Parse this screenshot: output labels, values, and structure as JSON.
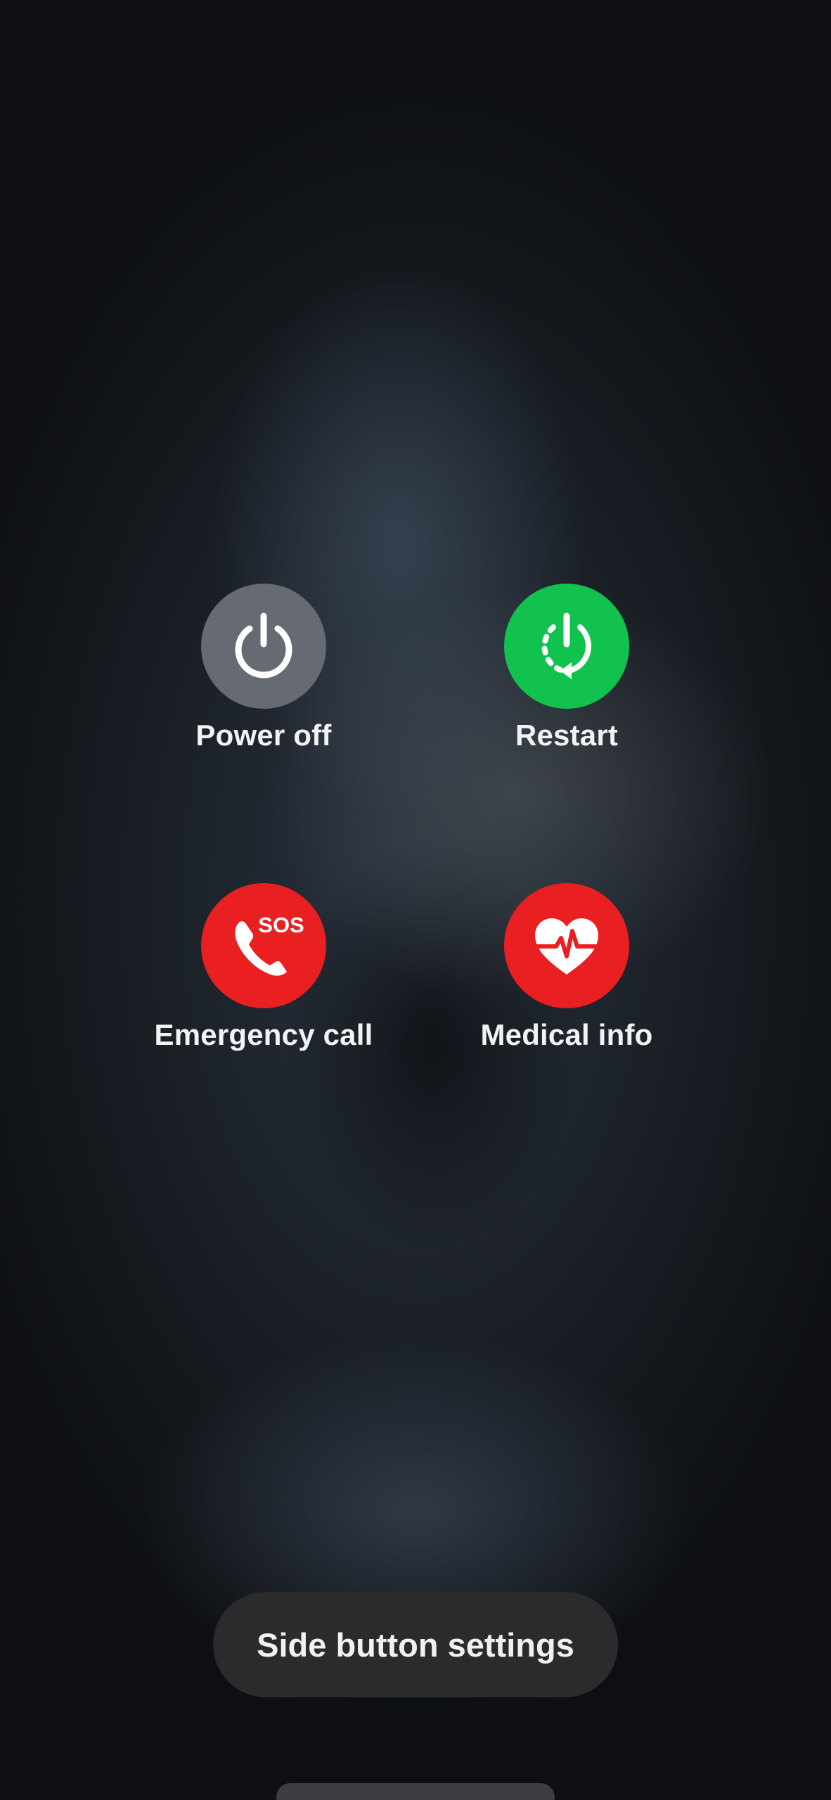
{
  "power_menu": {
    "power_off": {
      "label": "Power off",
      "icon": "power-icon",
      "color": "#666a72"
    },
    "restart": {
      "label": "Restart",
      "icon": "restart-icon",
      "color": "#11c24f"
    },
    "emergency_call": {
      "label": "Emergency call",
      "icon": "sos-phone-icon",
      "badge": "SOS",
      "color": "#ea1f22"
    },
    "medical_info": {
      "label": "Medical info",
      "icon": "heart-pulse-icon",
      "color": "#ea1f22"
    }
  },
  "side_button_settings": {
    "label": "Side button settings"
  }
}
